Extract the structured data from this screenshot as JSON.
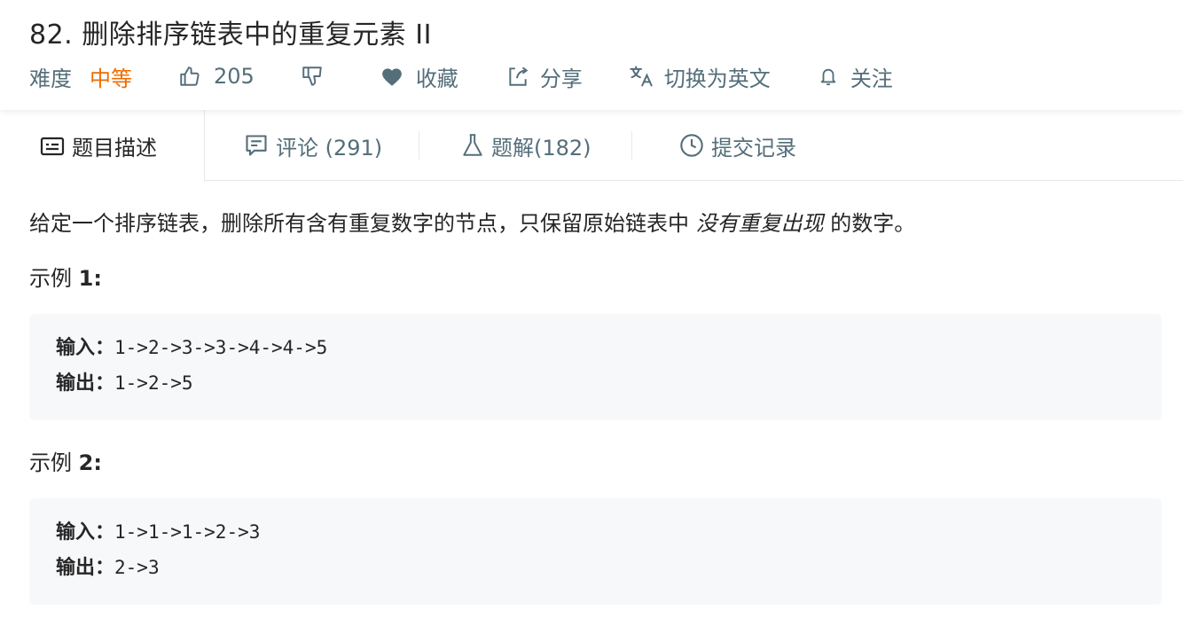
{
  "problem": {
    "title": "82. 删除排序链表中的重复元素 II",
    "difficulty_label": "难度",
    "difficulty_value": "中等",
    "likes": "205",
    "favorite_label": "收藏",
    "share_label": "分享",
    "translate_label": "切换为英文",
    "follow_label": "关注"
  },
  "tabs": {
    "description": "题目描述",
    "comments": "评论 (291)",
    "solutions": "题解(182)",
    "submissions": "提交记录"
  },
  "content": {
    "desc_prefix": "给定一个排序链表，删除所有含有重复数字的节点，只保留原始链表中 ",
    "desc_emph": "没有重复出现",
    "desc_suffix": " 的数字。",
    "examples": [
      {
        "title_prefix": "示例 ",
        "title_num": "1:",
        "input_label": "输入：",
        "input_value": "1->2->3->3->4->4->5",
        "output_label": "输出：",
        "output_value": "1->2->5"
      },
      {
        "title_prefix": "示例 ",
        "title_num": "2:",
        "input_label": "输入：",
        "input_value": "1->1->1->2->3",
        "output_label": "输出：",
        "output_value": "2->3"
      }
    ]
  },
  "icons": {
    "like": "thumbs-up-icon",
    "dislike": "thumbs-down-icon",
    "favorite": "heart-icon",
    "share": "share-icon",
    "translate": "translate-icon",
    "follow": "bell-icon",
    "description_tab": "description-icon",
    "comments_tab": "comment-icon",
    "solutions_tab": "flask-icon",
    "submissions_tab": "clock-icon"
  },
  "colors": {
    "difficulty_medium": "#ef6c00",
    "secondary_text": "#546e7a",
    "primary_text": "#262626",
    "code_background": "#f7f8fa"
  }
}
